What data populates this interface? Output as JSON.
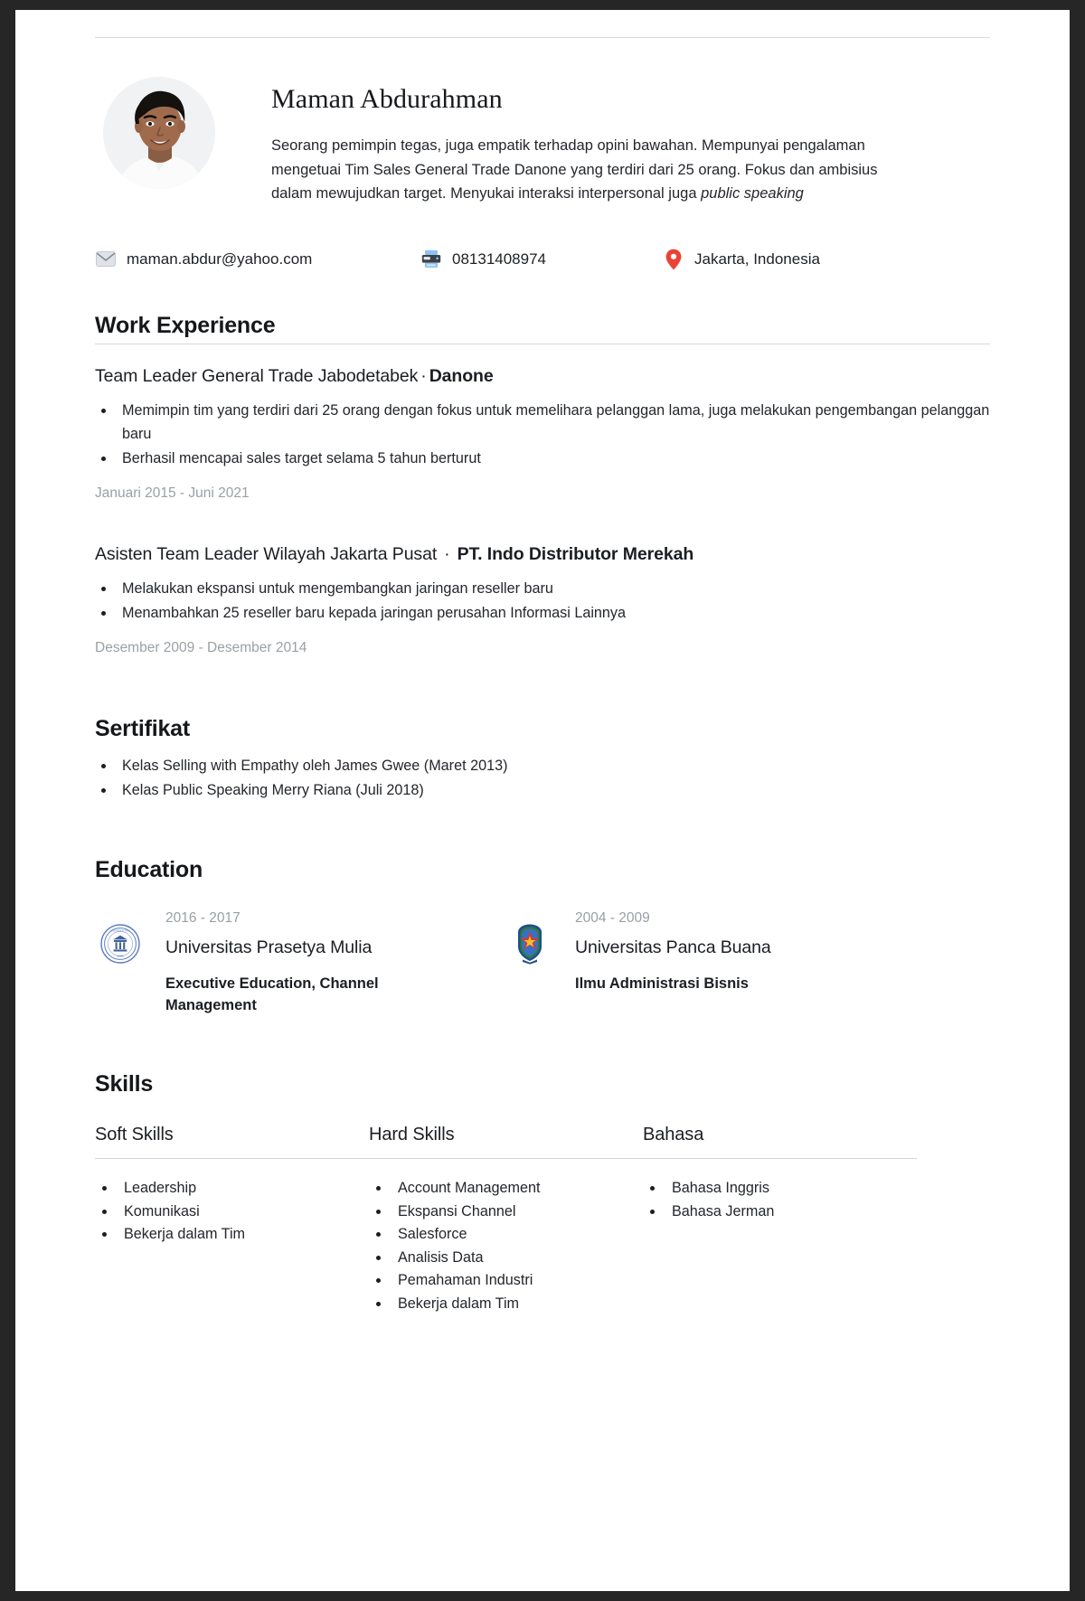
{
  "profile": {
    "name": "Maman Abdurahman",
    "summary_part1": "Seorang pemimpin tegas, juga empatik terhadap opini bawahan. Mempunyai pengalaman mengetuai Tim Sales General Trade Danone yang terdiri dari 25 orang. Fokus dan ambisius dalam mewujudkan target. Menyukai interaksi interpersonal juga ",
    "summary_italic": "public speaking"
  },
  "contact": {
    "email": "maman.abdur@yahoo.com",
    "phone": "08131408974",
    "location": "Jakarta, Indonesia"
  },
  "work_experience": {
    "title": "Work Experience",
    "jobs": [
      {
        "role": "Team Leader General Trade Jabodetabek",
        "separator": "·",
        "company": "Danone",
        "bullets": [
          "Memimpin tim yang terdiri dari 25 orang dengan fokus untuk memelihara pelanggan lama, juga melakukan pengembangan pelanggan baru",
          "Berhasil mencapai sales target selama 5 tahun berturut"
        ],
        "dates": "Januari 2015 - Juni 2021"
      },
      {
        "role": "Asisten Team Leader Wilayah Jakarta Pusat",
        "separator": "·",
        "company": "PT. Indo Distributor Merekah",
        "bullets": [
          "Melakukan ekspansi untuk mengembangkan jaringan reseller baru",
          "Menambahkan 25 reseller baru kepada jaringan perusahan Informasi Lainnya"
        ],
        "dates": "Desember 2009 - Desember 2014"
      }
    ]
  },
  "certificates": {
    "title": "Sertifikat",
    "items": [
      "Kelas Selling with Empathy oleh James Gwee (Maret 2013)",
      "Kelas Public Speaking Merry Riana (Juli 2018)"
    ]
  },
  "education": {
    "title": "Education",
    "entries": [
      {
        "years": "2016 - 2017",
        "school": "Universitas Prasetya Mulia",
        "major": "Executive Education, Channel Management",
        "logo": "university-seal-icon"
      },
      {
        "years": "2004 - 2009",
        "school": "Universitas Panca Buana",
        "major": "Ilmu Administrasi Bisnis",
        "logo": "university-crest-icon"
      }
    ]
  },
  "skills": {
    "title": "Skills",
    "columns": [
      {
        "heading": "Soft Skills",
        "items": [
          "Leadership",
          "Komunikasi",
          "Bekerja dalam Tim"
        ]
      },
      {
        "heading": "Hard Skills",
        "items": [
          "Account Management",
          "Ekspansi Channel",
          "Salesforce",
          "Analisis Data",
          "Pemahaman Industri",
          "Bekerja dalam Tim"
        ]
      },
      {
        "heading": "Bahasa",
        "items": [
          "Bahasa Inggris",
          "Bahasa Jerman"
        ]
      }
    ]
  },
  "icons": {
    "email": "envelope-icon",
    "phone": "fax-machine-icon",
    "location": "map-pin-icon",
    "avatar": "profile-photo"
  },
  "colors": {
    "page_background": "#ffffff",
    "backdrop": "#262626",
    "text": "#23262b",
    "muted": "#9aa0a6",
    "rule": "#d8d8d8",
    "pin_red": "#ea4335"
  }
}
